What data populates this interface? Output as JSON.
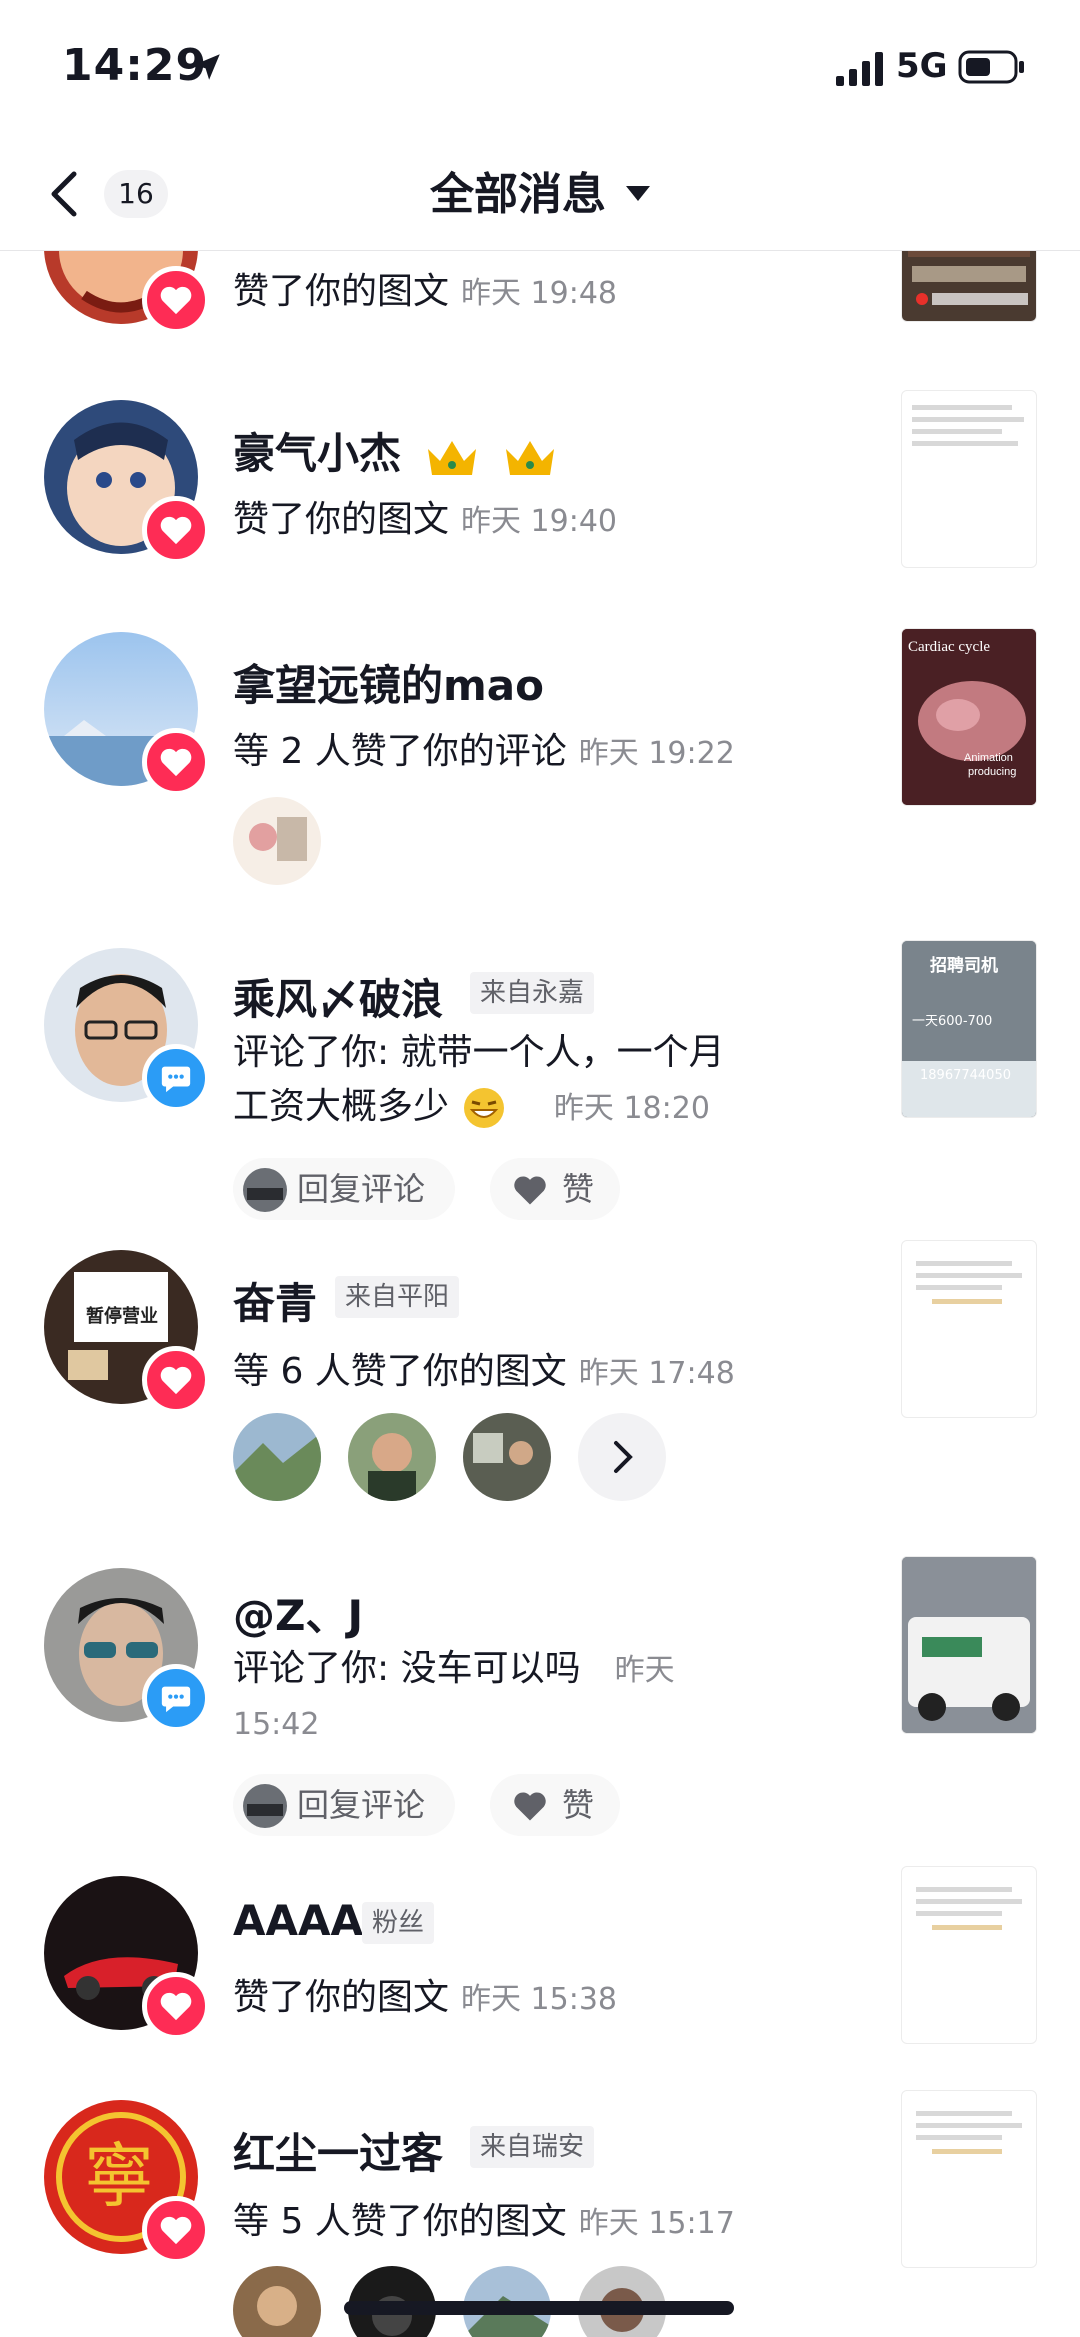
{
  "status_bar": {
    "time": "14:29",
    "network": "5G"
  },
  "header": {
    "unread_count": "16",
    "title": "全部消息"
  },
  "notifications": [
    {
      "description": "赞了你的图文",
      "time": "昨天 19:48",
      "badge": "like"
    },
    {
      "name": "豪气小杰",
      "description": "赞了你的图文",
      "time": "昨天 19:40",
      "badge": "like"
    },
    {
      "name": "拿望远镜的mao",
      "description": "等 2 人赞了你的评论",
      "time": "昨天 19:22",
      "badge": "like",
      "thumb_text": [
        "Cardiac cycle",
        "Animation",
        "producing"
      ]
    },
    {
      "name": "乘风〆破浪",
      "tag": "来自永嘉",
      "description_line1": "评论了你: 就带一个人，一个月",
      "description_line2": "工资大概多少",
      "time": "昨天 18:20",
      "badge": "comment",
      "reply_label": "回复评论",
      "like_label": "赞",
      "thumb_text": [
        "招聘司机",
        "一天600-700",
        "18967744050"
      ]
    },
    {
      "name": "奋青",
      "tag": "来自平阳",
      "description": "等 6 人赞了你的图文",
      "time": "昨天 17:48",
      "badge": "like",
      "avatar_sign": [
        "暂停营业"
      ]
    },
    {
      "name": "@Z、J",
      "description_line1": "评论了你: 没车可以吗",
      "time_part1": "昨天",
      "time_part2": "15:42",
      "badge": "comment",
      "reply_label": "回复评论",
      "like_label": "赞"
    },
    {
      "name": "AAAA",
      "tag": "粉丝",
      "description": "赞了你的图文",
      "time": "昨天 15:38",
      "badge": "like"
    },
    {
      "name": "红尘一过客",
      "tag": "来自瑞安",
      "description": "等 5 人赞了你的图文",
      "time": "昨天 15:17",
      "badge": "like",
      "avatar_glyph": "寧"
    }
  ],
  "colors": {
    "like": "#fe2c55",
    "comment": "#2b9cf6",
    "text": "#161823",
    "secondary": "#8a8b91"
  }
}
